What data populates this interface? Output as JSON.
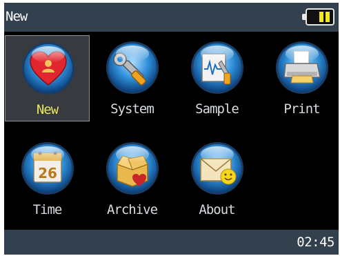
{
  "titlebar": {
    "title": "New"
  },
  "battery": {
    "level": 0.66
  },
  "apps": [
    {
      "label": "New",
      "icon": "new-heart-icon",
      "selected": true
    },
    {
      "label": "System",
      "icon": "wrench-icon",
      "selected": false
    },
    {
      "label": "Sample",
      "icon": "sample-tools-icon",
      "selected": false
    },
    {
      "label": "Print",
      "icon": "printer-icon",
      "selected": false
    },
    {
      "label": "Time",
      "icon": "calendar-icon",
      "selected": false
    },
    {
      "label": "Archive",
      "icon": "archive-box-icon",
      "selected": false
    },
    {
      "label": "About",
      "icon": "envelope-smiley-icon",
      "selected": false
    }
  ],
  "calendar": {
    "day": "26"
  },
  "statusbar": {
    "time": "02:45"
  },
  "colors": {
    "bar": "#33404d",
    "selected_label": "#e9e65c",
    "label": "#d8dde2",
    "battery": "#f2ea1c"
  }
}
